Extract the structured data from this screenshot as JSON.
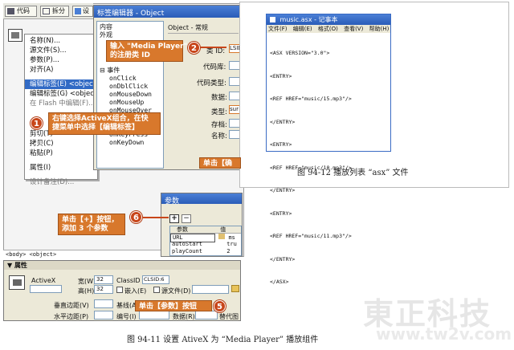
{
  "toolbar": {
    "code_label": "代码",
    "split_label": "拆分",
    "design_label": "设"
  },
  "tag_editor": {
    "title": "标签编辑器 - Object",
    "tree": {
      "content": "内容",
      "appearance": "外观",
      "events": "事件",
      "event_items": [
        "onClick",
        "onDblClick",
        "onMouseDown",
        "onMouseUp",
        "onMouseOver",
        "onMouseMove",
        "onMouseOut",
        "onKeyPress",
        "onKeyDown"
      ]
    },
    "panel_title": "Object - 常规",
    "fields": {
      "class_id_label": "类 ID:",
      "class_id_value": "LSID",
      "codebase_label": "代码库:",
      "codetype_label": "代码类型:",
      "data_label": "数据:",
      "type_label": "类型:",
      "type_value": "sur",
      "archive_label": "存档:",
      "name_label": "名称:"
    }
  },
  "context_menu": {
    "items": [
      "名称(N)...",
      "源文件(S)...",
      "参数(P)...",
      "对齐(A)",
      "编辑标签(E) <object>",
      "编辑标签(G) <object>",
      "在 Flash 中编辑(F)...",
      "剪切(T)",
      "拷贝(C)",
      "粘贴(P)",
      "属性(I)",
      "设计备注(D)..."
    ]
  },
  "callouts": {
    "c1": "右键选择ActiveX组合，在快\n捷菜单中选择【编辑标签】",
    "c2": "输入 \"Media Player\"\n的注册类 ID",
    "c3": "单击【确",
    "c5": "单击【参数】按钮",
    "c6": "单击【+】按钮，\n添加 3 个参数",
    "n1": "1",
    "n2": "2",
    "n5": "5",
    "n6": "6"
  },
  "params_dialog": {
    "title": "参数",
    "add_label": "+",
    "remove_label": "−",
    "col_param": "参数",
    "col_value": "值",
    "rows": [
      {
        "name": "URL",
        "value": "ms"
      },
      {
        "name": "autoStart",
        "value": "tru"
      },
      {
        "name": "playCount",
        "value": "2"
      }
    ]
  },
  "tag_selector": {
    "path": "<body> <object>"
  },
  "properties": {
    "header": "▼ 属性",
    "activex_label": "ActiveX",
    "width_label": "宽(W)",
    "width_value": "32",
    "height_label": "高(H)",
    "height_value": "32",
    "classid_label": "ClassID",
    "classid_value": "CLSID:6",
    "embed_label": "嵌入(E)",
    "source_label": "源文件(D)",
    "vspace_label": "垂直边距(V)",
    "align_label": "基线(A)",
    "hspace_label": "水平边距(P)",
    "id_label": "编号(I)",
    "data_label": "数据(R)",
    "alt_label": "替代图"
  },
  "notepad": {
    "title": "music.asx - 记事本",
    "menu": [
      "文件(F)",
      "编辑(E)",
      "格式(O)",
      "查看(V)",
      "帮助(H)"
    ],
    "lines": [
      "<ASX VERSION=\"3.0\">",
      "<ENTRY>",
      "<REF HREF=\"music/15.mp3\"/>",
      "</ENTRY>",
      "<ENTRY>",
      "<REF HREF=\"music/10.mp3\"/>",
      "</ENTRY>",
      "<ENTRY>",
      "<REF HREF=\"music/11.mp3\"/>",
      "</ENTRY>",
      "</ASX>"
    ]
  },
  "captions": {
    "fig12": "图 94-12   播放列表 “asx” 文件",
    "fig11": "图 94-11   设置 AtiveX 为 “Media Player” 播放组件"
  },
  "watermark": {
    "logo": "東正科技",
    "url": "www.tw2v.com"
  },
  "colors": {
    "callout": "#d8782c",
    "badge": "#c8461a",
    "titlebar": "#2a5cb8"
  }
}
